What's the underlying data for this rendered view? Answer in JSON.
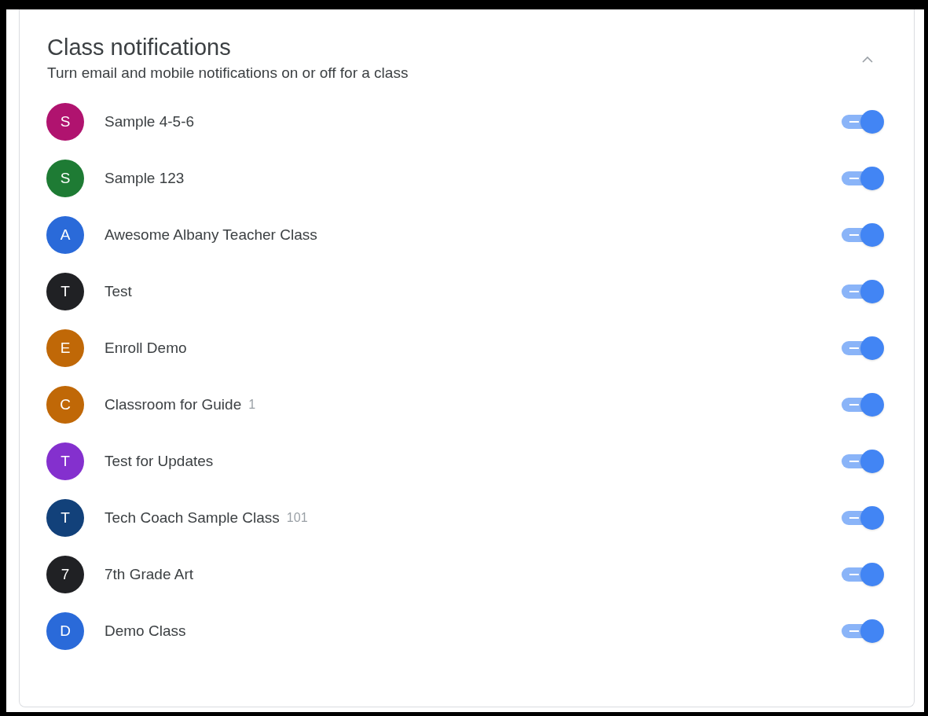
{
  "card": {
    "title": "Class notifications",
    "subtitle": "Turn email and mobile notifications on or off for a class",
    "expanded": true
  },
  "classes": [
    {
      "initial": "S",
      "name": "Sample 4-5-6",
      "color": "#b0136f",
      "on": true
    },
    {
      "initial": "S",
      "name": "Sample 123",
      "color": "#1e7b34",
      "on": true
    },
    {
      "initial": "A",
      "name": "Awesome Albany Teacher Class",
      "color": "#2a6ad9",
      "on": true
    },
    {
      "initial": "T",
      "name": "Test",
      "color": "#202124",
      "on": true
    },
    {
      "initial": "E",
      "name": "Enroll Demo",
      "color": "#c06807",
      "on": true
    },
    {
      "initial": "C",
      "name": "Classroom for Guide",
      "section": "1",
      "color": "#c06807",
      "on": true
    },
    {
      "initial": "T",
      "name": "Test for Updates",
      "color": "#8430ce",
      "on": true
    },
    {
      "initial": "T",
      "name": "Tech Coach Sample Class",
      "section": "101",
      "color": "#12417a",
      "on": true
    },
    {
      "initial": "7",
      "name": "7th Grade Art",
      "color": "#202124",
      "on": true
    },
    {
      "initial": "D",
      "name": "Demo Class",
      "color": "#2a6ad9",
      "on": true
    }
  ]
}
